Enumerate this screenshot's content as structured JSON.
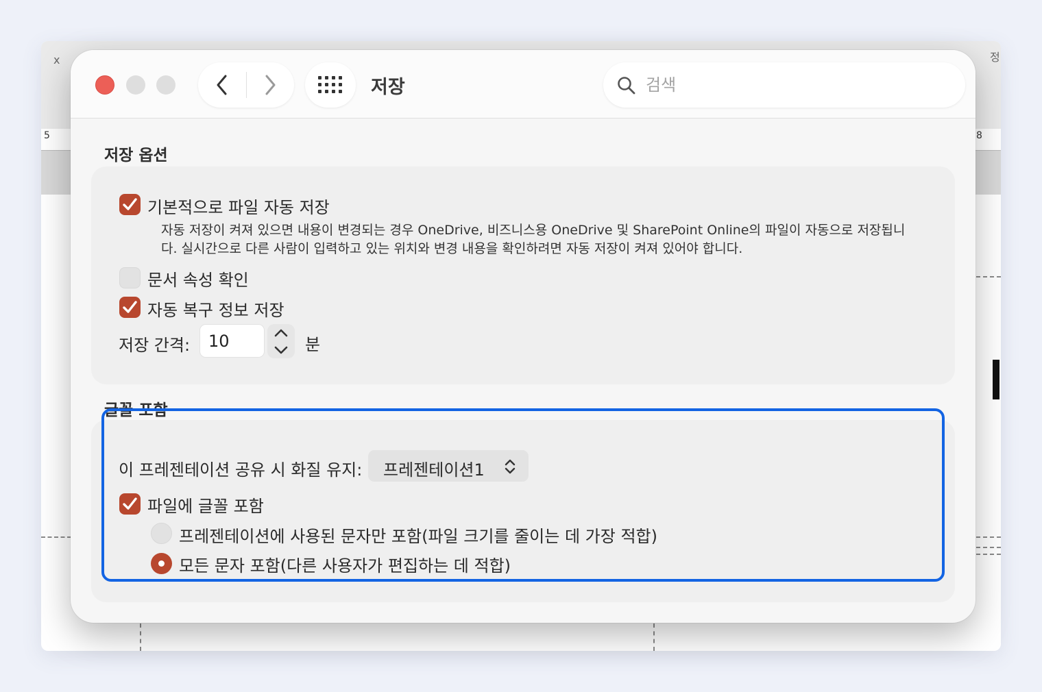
{
  "background_app": {
    "ruler_left": "5",
    "ruler_right": "8",
    "corner_left": "x",
    "corner_right": "정"
  },
  "dialog": {
    "title": "저장",
    "search": {
      "placeholder": "검색",
      "value": ""
    },
    "save_options": {
      "title": "저장 옵션",
      "autosave": {
        "label": "기본적으로 파일 자동 저장",
        "checked": true,
        "description": "자동 저장이 켜져 있으면 내용이 변경되는 경우 OneDrive, 비즈니스용 OneDrive 및 SharePoint Online의 파일이 자동으로 저장됩니다. 실시간으로 다른 사람이 입력하고 있는 위치와 변경 내용을 확인하려면 자동 저장이 켜져 있어야 합니다."
      },
      "doc_props": {
        "label": "문서 속성 확인",
        "checked": false
      },
      "autorecover": {
        "label": "자동 복구 정보 저장",
        "checked": true
      },
      "interval": {
        "label": "저장 간격:",
        "value": "10",
        "unit": "분"
      }
    },
    "font_embed": {
      "title": "글꼴 포함",
      "keep_quality_label": "이 프레젠테이션 공유 시 화질 유지:",
      "presentation_select": "프레젠테이션1",
      "embed_fonts": {
        "label": "파일에 글꼴 포함",
        "checked": true
      },
      "radio_used_only": {
        "label": "프레젠테이션에 사용된 문자만 포함(파일 크기를 줄이는 데 가장 적합)",
        "selected": false
      },
      "radio_all": {
        "label": "모든 문자 포함(다른 사용자가 편집하는 데 적합)",
        "selected": true
      }
    }
  },
  "colors": {
    "accent": "#b8472e",
    "highlight": "#1364e3",
    "close": "#ec5f57"
  }
}
